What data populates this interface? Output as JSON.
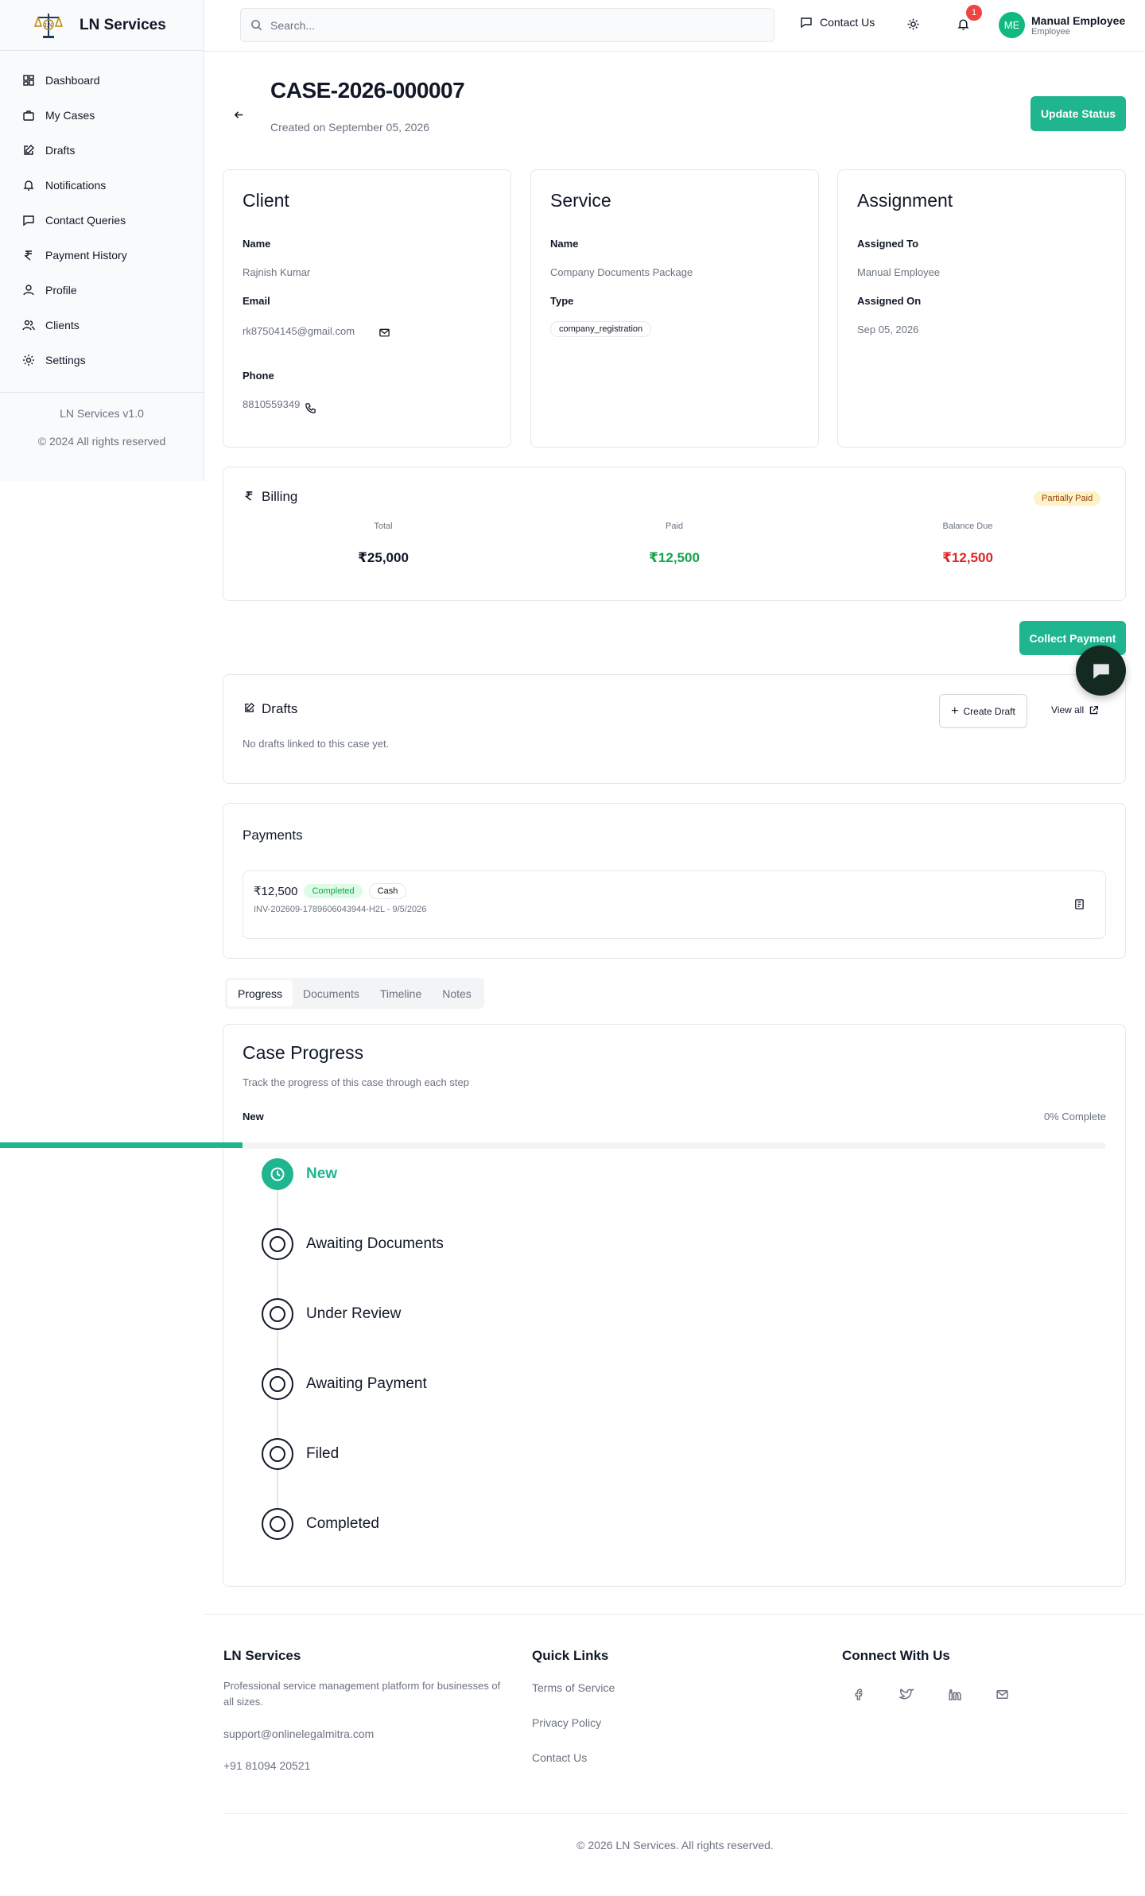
{
  "app": {
    "name": "LN Services"
  },
  "sidebar": {
    "items": [
      {
        "label": "Dashboard"
      },
      {
        "label": "My Cases"
      },
      {
        "label": "Drafts"
      },
      {
        "label": "Notifications"
      },
      {
        "label": "Contact Queries"
      },
      {
        "label": "Payment History"
      },
      {
        "label": "Profile"
      },
      {
        "label": "Clients"
      },
      {
        "label": "Settings"
      }
    ],
    "version": "LN Services v1.0",
    "copyright": "© 2024 All rights reserved"
  },
  "topbar": {
    "search_placeholder": "Search...",
    "contact_label": "Contact Us",
    "notification_count": "1",
    "user": {
      "initials": "ME",
      "name": "Manual Employee",
      "role": "Employee"
    }
  },
  "case": {
    "title": "CASE-2026-000007",
    "created": "Created on September 05, 2026",
    "update_status_label": "Update Status"
  },
  "client": {
    "heading": "Client",
    "name_label": "Name",
    "name": "Rajnish Kumar",
    "email_label": "Email",
    "email": "rk87504145@gmail.com",
    "phone_label": "Phone",
    "phone": "8810559349"
  },
  "service": {
    "heading": "Service",
    "name_label": "Name",
    "name": "Company Documents Package",
    "type_label": "Type",
    "type": "company_registration"
  },
  "assignment": {
    "heading": "Assignment",
    "assigned_to_label": "Assigned To",
    "assigned_to": "Manual Employee",
    "assigned_on_label": "Assigned On",
    "assigned_on": "Sep 05, 2026"
  },
  "billing": {
    "heading": "Billing",
    "status": "Partially Paid",
    "total_label": "Total",
    "total": "₹25,000",
    "paid_label": "Paid",
    "paid": "₹12,500",
    "balance_label": "Balance Due",
    "balance": "₹12,500",
    "collect_label": "Collect Payment"
  },
  "drafts": {
    "heading": "Drafts",
    "create_label": "Create Draft",
    "view_all_label": "View all",
    "empty_text": "No drafts linked to this case yet."
  },
  "payments": {
    "heading": "Payments",
    "items": [
      {
        "amount": "₹12,500",
        "status": "Completed",
        "method": "Cash",
        "details": "INV-202609-1789606043944-H2L - 9/5/2026"
      }
    ]
  },
  "tabs": [
    {
      "label": "Progress"
    },
    {
      "label": "Documents"
    },
    {
      "label": "Timeline"
    },
    {
      "label": "Notes"
    }
  ],
  "progress": {
    "heading": "Case Progress",
    "subtitle": "Track the progress of this case through each step",
    "current": "New",
    "percent_text": "0% Complete",
    "steps": [
      {
        "label": "New"
      },
      {
        "label": "Awaiting Documents"
      },
      {
        "label": "Under Review"
      },
      {
        "label": "Awaiting Payment"
      },
      {
        "label": "Filed"
      },
      {
        "label": "Completed"
      }
    ]
  },
  "footer": {
    "brand": "LN Services",
    "description": "Professional service management platform for businesses of all sizes.",
    "email": "support@onlinelegalmitra.com",
    "phone": "+91 81094 20521",
    "quick_links_heading": "Quick Links",
    "links": [
      {
        "label": "Terms of Service"
      },
      {
        "label": "Privacy Policy"
      },
      {
        "label": "Contact Us"
      }
    ],
    "connect_heading": "Connect With Us",
    "copyright": "© 2026 LN Services. All rights reserved."
  },
  "colors": {
    "accent": "#1fb58f",
    "paid": "#16a34a",
    "due": "#dc2626",
    "badge": "#ef4444"
  }
}
